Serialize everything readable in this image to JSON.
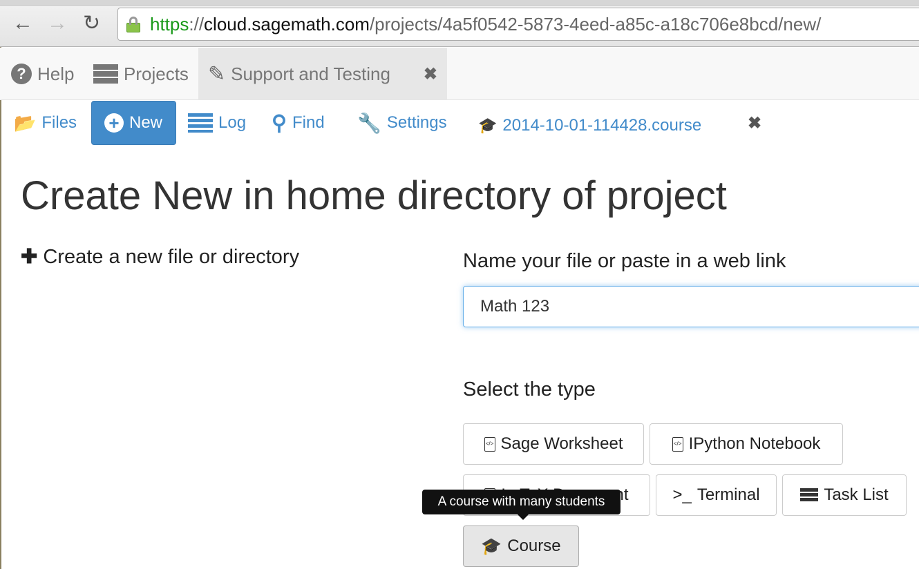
{
  "browser": {
    "url_scheme": "https",
    "url_sep": "://",
    "url_host": "cloud.sagemath.com",
    "url_path": "/projects/4a5f0542-5873-4eed-a85c-a18c706e8bcd/new/"
  },
  "topbar": {
    "help": "Help",
    "projects": "Projects",
    "active_project": "Support and Testing"
  },
  "project_nav": {
    "files": "Files",
    "new": "New",
    "log": "Log",
    "find": "Find",
    "settings": "Settings",
    "open_file": "2014-10-01-114428.course"
  },
  "main": {
    "title": "Create New in home directory of project",
    "create_label": "Create a new file or directory",
    "name_label": "Name your file or paste in a web link",
    "name_value": "Math 123",
    "type_label": "Select the type",
    "types": [
      "Sage Worksheet",
      "IPython Notebook",
      "LaTeX Document",
      "Terminal",
      "Task List",
      "Course"
    ],
    "selected_type": "Course",
    "tooltip": "A course with many students"
  },
  "colors": {
    "accent": "#428bca",
    "https": "#1a9a1a"
  }
}
